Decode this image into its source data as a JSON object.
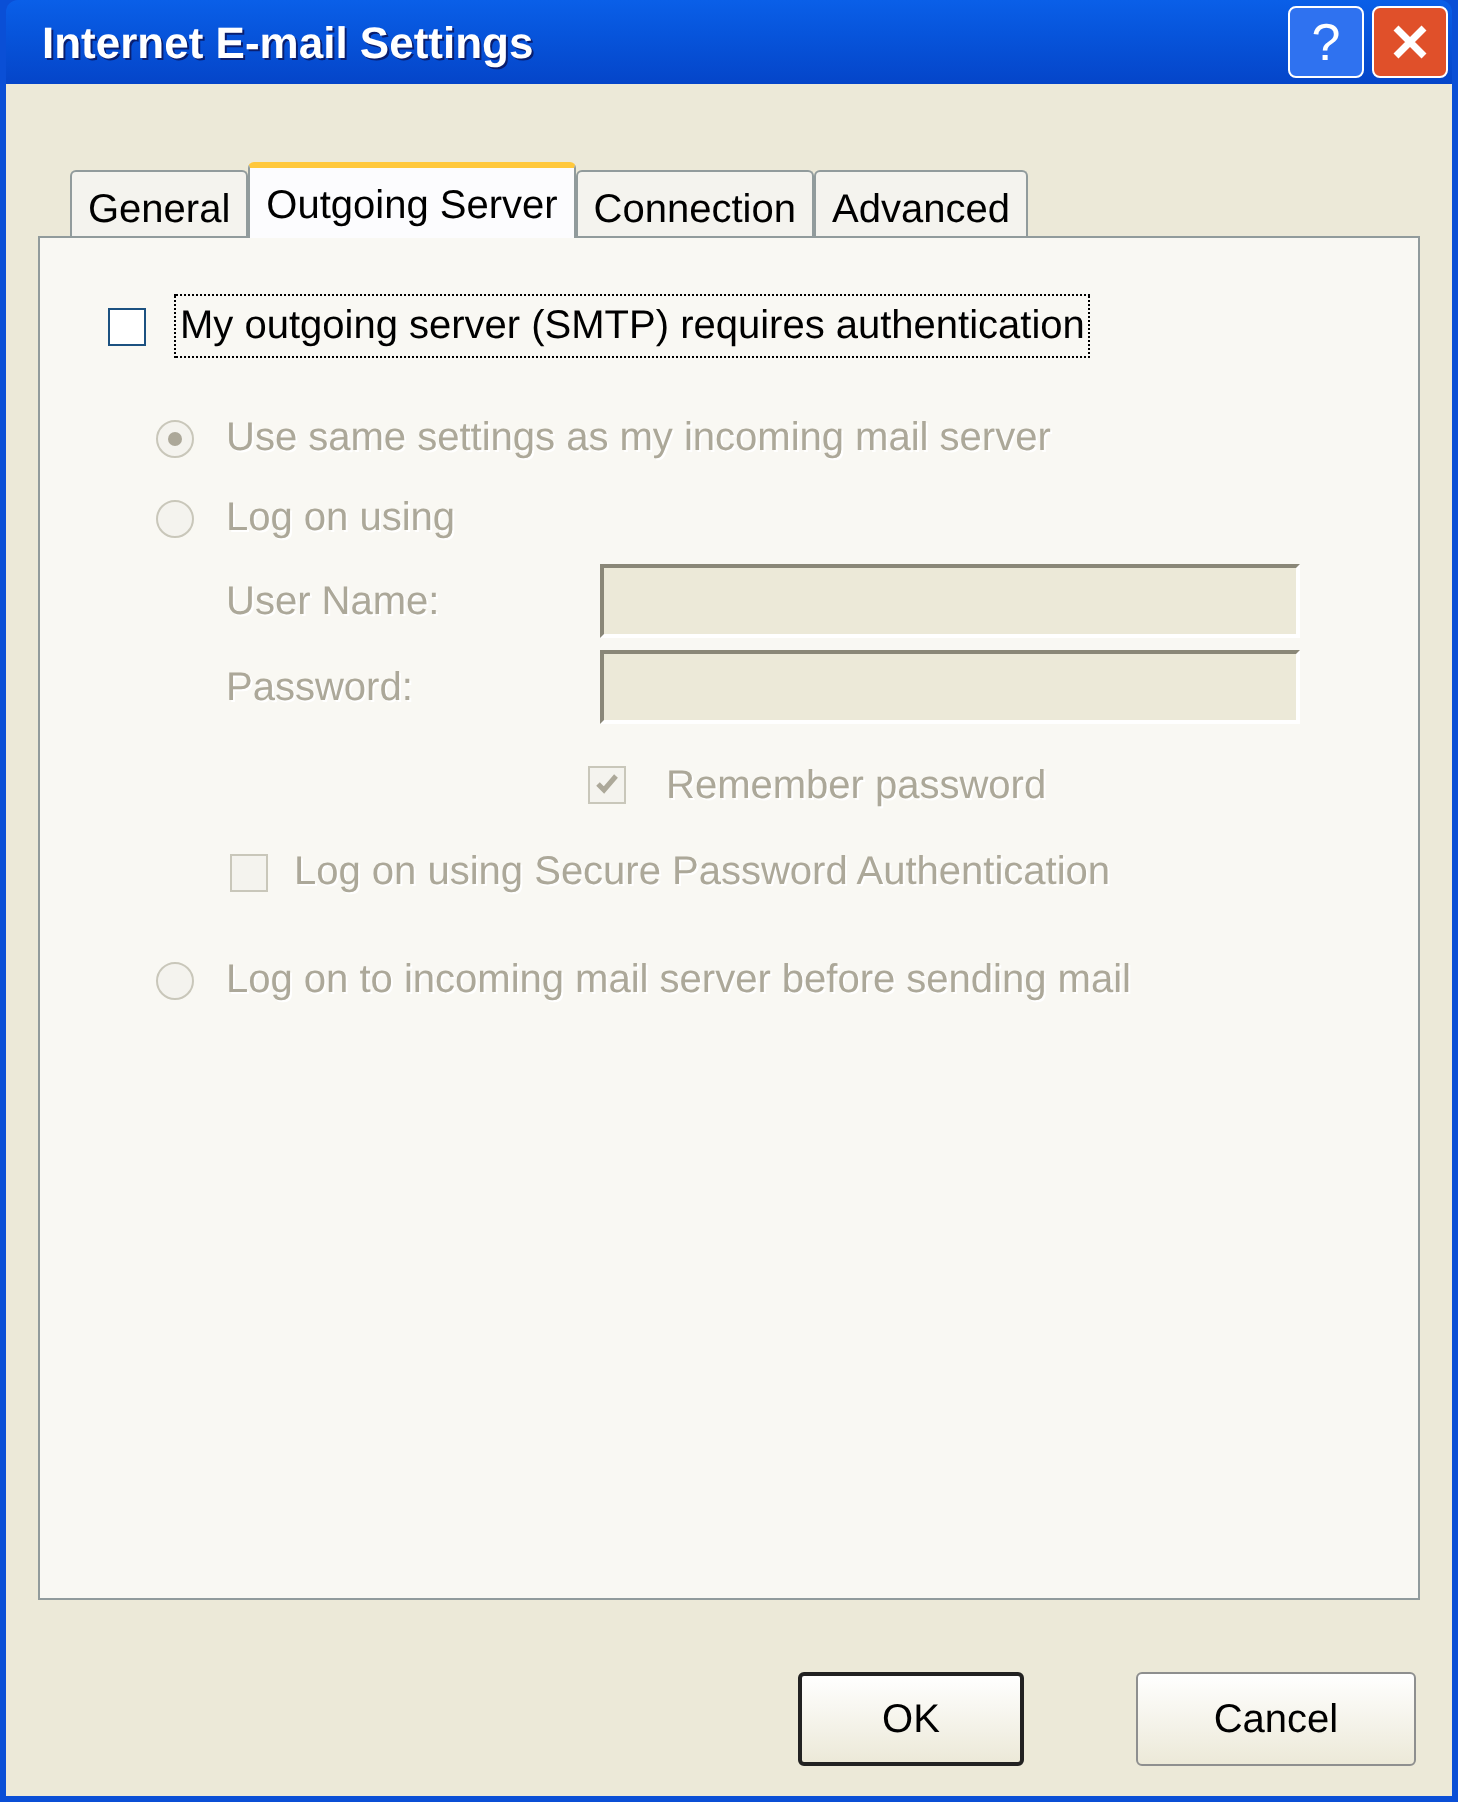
{
  "window": {
    "title": "Internet E-mail Settings",
    "help_label": "?"
  },
  "tabs": [
    {
      "label": "General",
      "selected": false
    },
    {
      "label": "Outgoing Server",
      "selected": true
    },
    {
      "label": "Connection",
      "selected": false
    },
    {
      "label": "Advanced",
      "selected": false
    }
  ],
  "auth": {
    "label": "My outgoing server (SMTP) requires authentication",
    "checked": false,
    "focused": true
  },
  "logon_options": [
    {
      "kind": "radio",
      "label": "Use same settings as my incoming mail server",
      "selected": true,
      "disabled": true
    },
    {
      "kind": "radio",
      "label": "Log on using",
      "selected": false,
      "disabled": true
    },
    {
      "kind": "field",
      "label": "User Name:",
      "disabled": true
    },
    {
      "kind": "field",
      "label": "Password:",
      "disabled": true
    },
    {
      "kind": "field_check",
      "label": "Remember password",
      "checked": true,
      "disabled": true
    },
    {
      "kind": "check",
      "label": "Log on using Secure Password Authentication",
      "checked": false,
      "disabled": true
    },
    {
      "kind": "radio",
      "label": "Log on to incoming mail server before sending mail",
      "selected": false,
      "disabled": true
    }
  ],
  "buttons": [
    {
      "label": "OK",
      "default": true
    },
    {
      "label": "Cancel",
      "default": false
    }
  ]
}
